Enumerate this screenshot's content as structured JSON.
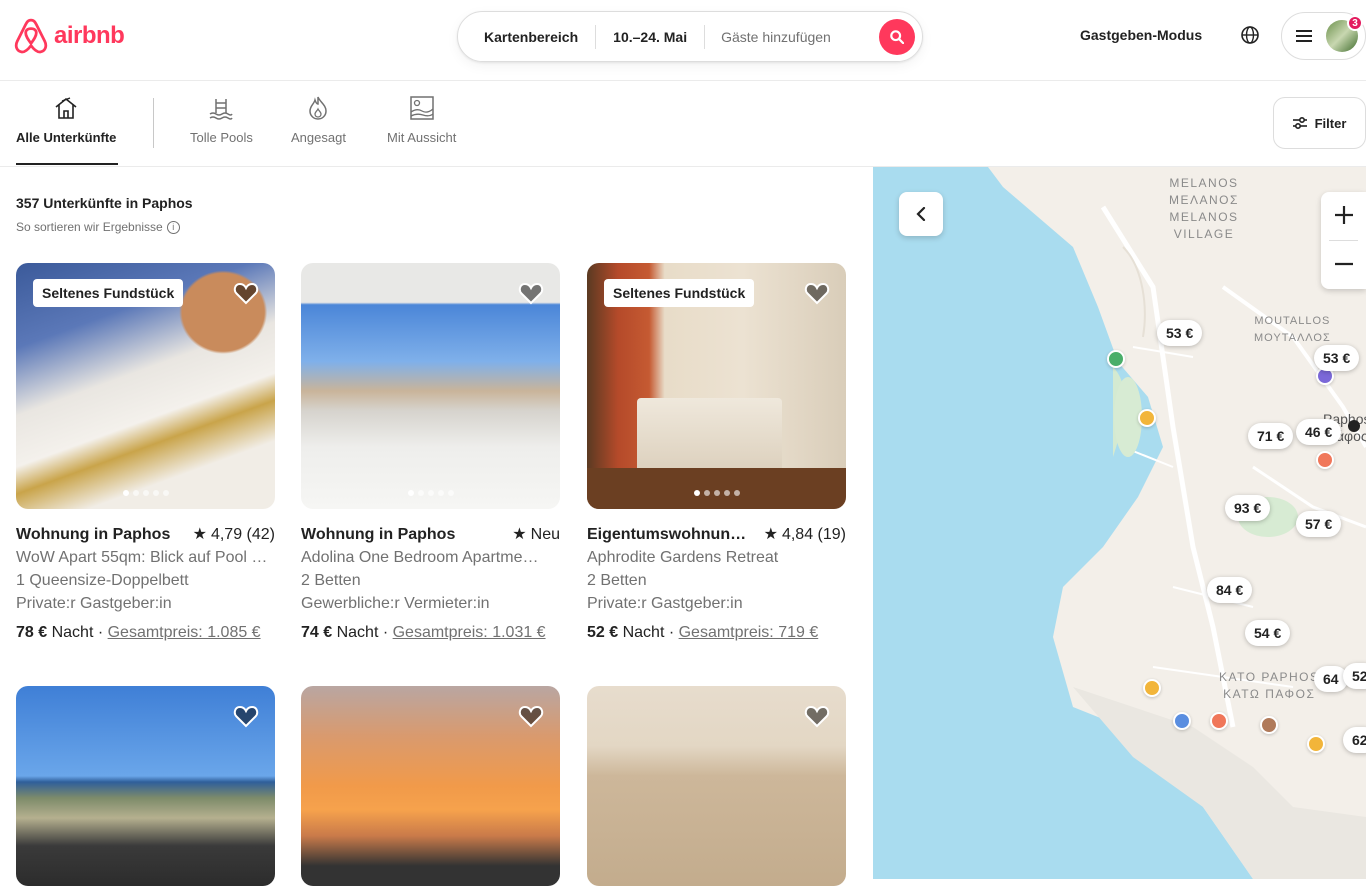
{
  "header": {
    "logo_text": "airbnb",
    "brand_color": "#FF385C",
    "search": {
      "location": "Kartenbereich",
      "dates": "10.–24. Mai",
      "guests_placeholder": "Gäste hinzufügen"
    },
    "host_link": "Gastgeben-Modus",
    "notification_count": "3"
  },
  "categories": [
    {
      "label": "Alle Unterkünfte",
      "icon": "home-icon",
      "active": true
    },
    {
      "label": "Tolle Pools",
      "icon": "pool-icon",
      "active": false
    },
    {
      "label": "Angesagt",
      "icon": "flame-icon",
      "active": false
    },
    {
      "label": "Mit Aussicht",
      "icon": "view-icon",
      "active": false
    }
  ],
  "filter_label": "Filter",
  "results": {
    "heading": "357 Unterkünfte in Paphos",
    "sort_note": "So sortieren wir Ergebnisse"
  },
  "listings": [
    {
      "badge": "Seltenes Fundstück",
      "title": "Wohnung in Paphos",
      "rating": "4,79 (42)",
      "desc": "WoW Apart 55qm: Blick auf Pool …",
      "beds": "1 Queensize-Doppelbett",
      "host": "Private:r Gastgeber:in",
      "price": "78 €",
      "unit": "Nacht",
      "total": "Gesamtpreis: 1.085 €"
    },
    {
      "badge": "",
      "title": "Wohnung in Paphos",
      "rating": "Neu",
      "desc": "Adolina One Bedroom Apartme…",
      "beds": "2 Betten",
      "host": "Gewerbliche:r Vermieter:in",
      "price": "74 €",
      "unit": "Nacht",
      "total": "Gesamtpreis: 1.031 €"
    },
    {
      "badge": "Seltenes Fundstück",
      "title": "Eigentumswohnun…",
      "rating": "4,84 (19)",
      "desc": "Aphrodite Gardens  Retreat",
      "beds": "2 Betten",
      "host": "Private:r Gastgeber:in",
      "price": "52 €",
      "unit": "Nacht",
      "total": "Gesamtpreis: 719 €"
    },
    {
      "badge": "",
      "title": "",
      "rating": "",
      "desc": "",
      "beds": "",
      "host": "",
      "price": "",
      "unit": "",
      "total": ""
    },
    {
      "badge": "",
      "title": "",
      "rating": "",
      "desc": "",
      "beds": "",
      "host": "",
      "price": "",
      "unit": "",
      "total": ""
    },
    {
      "badge": "",
      "title": "",
      "rating": "",
      "desc": "",
      "beds": "",
      "host": "",
      "price": "",
      "unit": "",
      "total": ""
    }
  ],
  "map": {
    "labels": [
      "MELANOS",
      "ΜΕΛΑΝΟΣ",
      "MELANOS",
      "VILLAGE",
      "MOUTALLOS",
      "ΜΟΥΤΑΛΛΟΣ",
      "Paphos",
      "Πάφος",
      "KATO PAPHOS",
      "ΚΑΤΩ ΠΑΦΟΣ"
    ],
    "pins": [
      "53 €",
      "53 €",
      "71 €",
      "46 €",
      "93 €",
      "57 €",
      "84 €",
      "54 €",
      "64",
      "52",
      "62"
    ]
  }
}
